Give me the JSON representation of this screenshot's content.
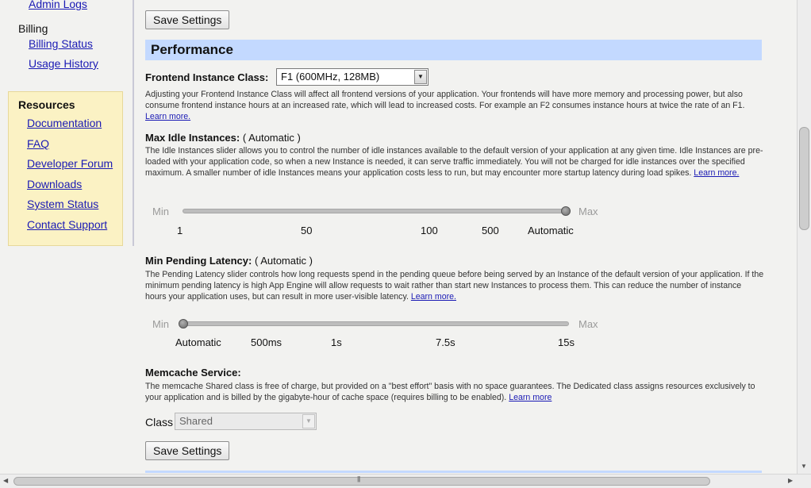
{
  "sidebar": {
    "admin_logs": "Admin Logs",
    "billing_heading": "Billing",
    "billing_status": "Billing Status",
    "usage_history": "Usage History",
    "resources": {
      "title": "Resources",
      "links": [
        "Documentation",
        "FAQ",
        "Developer Forum",
        "Downloads",
        "System Status",
        "Contact Support"
      ]
    }
  },
  "main": {
    "save_button_top": "Save Settings",
    "save_button_bottom": "Save Settings",
    "section_title": "Performance",
    "frontend": {
      "label": "Frontend Instance Class:",
      "selected": "F1 (600MHz, 128MB)",
      "description": "Adjusting your Frontend Instance Class will affect all frontend versions of your application. Your frontends will have more memory and processing power, but also consume frontend instance hours at an increased rate, which will lead to increased costs. For example an F2 consumes instance hours at twice the rate of an F1.",
      "learn_more": "Learn more."
    },
    "max_idle": {
      "label": "Max Idle Instances:",
      "value": "( Automatic )",
      "description": "The Idle Instances slider allows you to control the number of idle instances available to the default version of your application at any given time. Idle Instances are pre-loaded with your application code, so when a new Instance is needed, it can serve traffic immediately. You will not be charged for idle instances over the specified maximum. A smaller number of idle Instances means your application costs less to run, but may encounter more startup latency during load spikes.",
      "learn_more": "Learn more.",
      "min_label": "Min",
      "max_label": "Max",
      "ticks": [
        "1",
        "50",
        "100",
        "500",
        "Automatic"
      ],
      "slider_value": 1.0
    },
    "min_pending": {
      "label": "Min Pending Latency:",
      "value": "( Automatic )",
      "description": "The Pending Latency slider controls how long requests spend in the pending queue before being served by an Instance of the default version of your application. If the minimum pending latency is high App Engine will allow requests to wait rather than start new Instances to process them. This can reduce the number of instance hours your application uses, but can result in more user-visible latency.",
      "learn_more": "Learn more.",
      "min_label": "Min",
      "max_label": "Max",
      "ticks": [
        "Automatic",
        "500ms",
        "1s",
        "7.5s",
        "15s"
      ],
      "slider_value": 0.0
    },
    "memcache": {
      "label": "Memcache Service:",
      "description": "The memcache Shared class is free of charge, but provided on a \"best effort\" basis with no space guarantees. The Dedicated class assigns resources exclusively to your application and is billed by the gigabyte-hour of cache space (requires billing to be enabled).",
      "learn_more": "Learn more",
      "class_label": "Class",
      "class_selected": "Shared"
    }
  },
  "colors": {
    "link": "#1a1ab4",
    "section_header_bg": "#c3d9ff",
    "resources_bg": "#fbf2c4"
  }
}
